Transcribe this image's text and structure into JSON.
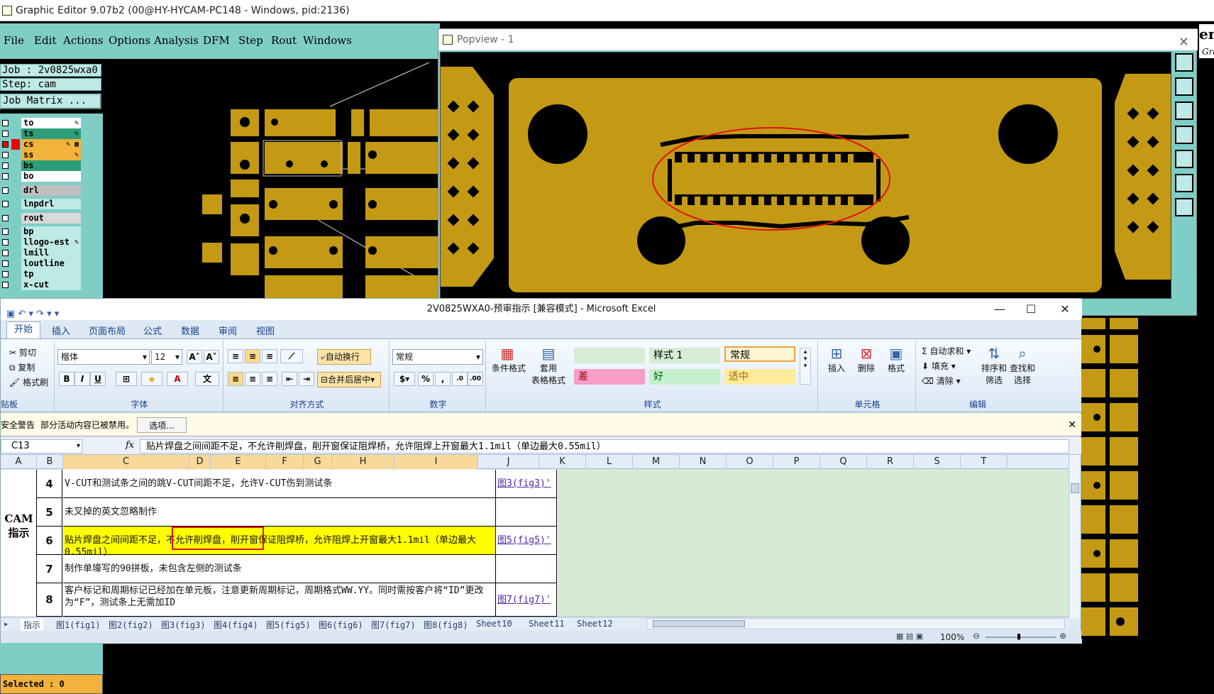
{
  "ge": {
    "title": "Graphic Editor 9.07b2 (00@HY-HYCAM-PC148 - Windows, pid:2136)",
    "menu": [
      "File",
      "Edit",
      "Actions",
      "Options",
      "Analysis",
      "DFM",
      "Step",
      "Rout",
      "Windows"
    ],
    "job_line": "Job : 2v0825wxa0",
    "step_line": "Step: cam",
    "matrix_button": "Job Matrix ...",
    "layers": [
      {
        "name": "to",
        "bg": "#ffffff",
        "mark": "✎"
      },
      {
        "name": "ts",
        "bg": "#2e9e78",
        "mark": "✎"
      },
      {
        "name": "cs",
        "bg": "#f2b23c",
        "mark": "✎ ▦"
      },
      {
        "name": "ss",
        "bg": "#f2b23c",
        "mark": "✎"
      },
      {
        "name": "bs",
        "bg": "#2e9e78",
        "mark": ""
      },
      {
        "name": "bo",
        "bg": "#ffffff",
        "mark": ""
      },
      {
        "name": "drl",
        "bg": "#bfbfbf",
        "mark": ""
      },
      {
        "name": "lnpdrl",
        "bg": "#bfe9e4",
        "mark": ""
      },
      {
        "name": "rout",
        "bg": "#d9d9d9",
        "mark": ""
      },
      {
        "name": "bp",
        "bg": "#bfe9e4",
        "mark": ""
      },
      {
        "name": "llogo-est",
        "bg": "#bfe9e4",
        "mark": "✎"
      },
      {
        "name": "lmill",
        "bg": "#bfe9e4",
        "mark": ""
      },
      {
        "name": "loutline",
        "bg": "#bfe9e4",
        "mark": ""
      },
      {
        "name": "tp",
        "bg": "#bfe9e4",
        "mark": ""
      },
      {
        "name": "x-cut",
        "bg": "#bfe9e4",
        "mark": ""
      }
    ],
    "selected": "Selected : 0",
    "right_edge_text": "en",
    "right_edge_sub": "Gra"
  },
  "popview": {
    "title": "Popview - 1",
    "close": "✕"
  },
  "excel": {
    "title": "2V0825WXA0-预审指示 [兼容模式] - Microsoft Excel",
    "qat": "▣ ↶ ▾ ↷ ▾ ▾",
    "tabs": [
      "开始",
      "插入",
      "页面布局",
      "公式",
      "数据",
      "审阅",
      "视图"
    ],
    "clipboard": {
      "cut": "剪切",
      "copy": "复制",
      "painter": "格式刷",
      "label": "贴板"
    },
    "font": {
      "name": "楷体",
      "size": "12",
      "label": "字体",
      "bold": "B",
      "italic": "I",
      "underline": "U"
    },
    "align": {
      "wrap": "自动换行",
      "merge": "合并后居中",
      "label": "对齐方式"
    },
    "number": {
      "format": "常规",
      "label": "数字",
      "pct": "%",
      "comma": ","
    },
    "styles": {
      "cond": "条件格式",
      "table": "套用",
      "table2": "表格格式",
      "style1": "样式 1",
      "normal": "常规",
      "bad": "差",
      "good": "好",
      "neutral": "适中",
      "label": "样式"
    },
    "cells": {
      "insert": "插入",
      "delete": "删除",
      "format": "格式",
      "label": "单元格"
    },
    "edit": {
      "autosum": "自动求和",
      "fill": "填充",
      "clear": "清除",
      "sort": "排序和",
      "sort2": "筛选",
      "find": "查找和",
      "find2": "选择",
      "label": "编辑"
    },
    "security": {
      "warn": "安全警告",
      "msg": "部分活动内容已被禁用。",
      "btn": "选项..."
    },
    "namebox": "C13",
    "fx": "fx",
    "formula": "贴片焊盘之间间距不足，不允许削焊盘，削开窗保证阻焊桥，允许阻焊上开窗最大1.1mil（单边最大0.55mil）",
    "columns": [
      "A",
      "B",
      "C",
      "D",
      "E",
      "F",
      "G",
      "H",
      "I",
      "J",
      "K",
      "L",
      "M",
      "N",
      "O",
      "P",
      "Q",
      "R",
      "S",
      "T"
    ],
    "merged_label_a": "CAM",
    "merged_label_b": "指示",
    "rows": [
      {
        "no": "4",
        "text": "V-CUT和测试条之间的跳V-CUT间距不足，允许V-CUT伤到测试条",
        "link": "图3(fig3)'"
      },
      {
        "no": "5",
        "text": "未叉掉的英文忽略制作",
        "link": ""
      },
      {
        "no": "6",
        "text": "贴片焊盘之间间距不足，不允许削焊盘，削开窗保证阻焊桥，允许阻焊上开窗最大1.1mil（单边最大0.55mil）",
        "link": "图5(fig5)'"
      },
      {
        "no": "7",
        "text": "制作单壕写的90拼板，未包含左侧的测试条",
        "link": ""
      },
      {
        "no": "8",
        "text": "客户标记和周期标记已经加在单元板，注意更新周期标记，周期格式WW.YY。同时需按客户将“ID”更改为“F”，测试条上无需加ID",
        "link": "图7(fig7)'"
      }
    ],
    "sheets": [
      "指示",
      "图1(fig1)",
      "图2(fig2)",
      "图3(fig3)",
      "图4(fig4)",
      "图5(fig5)",
      "图6(fig6)",
      "图7(fig7)",
      "图8(fig8)",
      "Sheet10",
      "Sheet11",
      "Sheet12"
    ],
    "zoom": "100%",
    "winbtns": {
      "min": "—",
      "max": "☐",
      "close": "✕"
    }
  }
}
